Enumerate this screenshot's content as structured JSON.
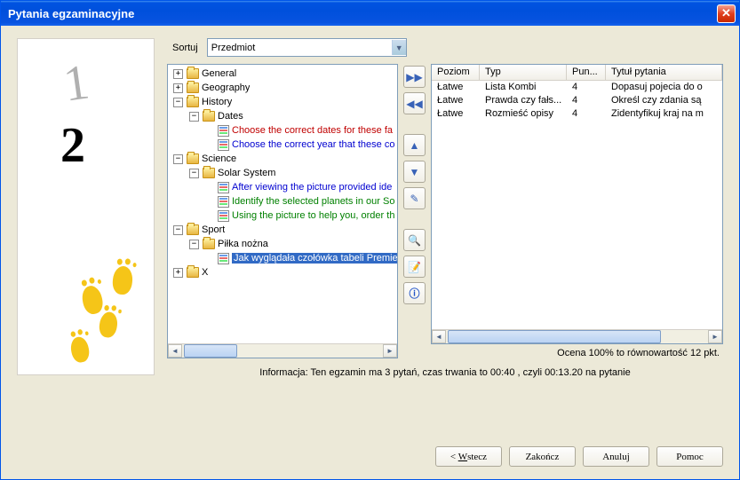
{
  "window": {
    "title": "Pytania egzaminacyjne"
  },
  "sort": {
    "label": "Sortuj",
    "value": "Przedmiot"
  },
  "tree": {
    "general": "General",
    "geography": "Geography",
    "history": "History",
    "dates": "Dates",
    "dates_q1": "Choose the correct dates for these fa",
    "dates_q2": "Choose the correct year that these co",
    "science": "Science",
    "solar": "Solar System",
    "solar_q1": "After viewing the picture provided ide",
    "solar_q2": "Identify the selected planets in our So",
    "solar_q3": "Using the picture to help you, order th",
    "sport": "Sport",
    "pilka": "Piłka nożna",
    "pilka_q1": "Jak wyglądała czołówka tabeli Premie",
    "x": "X"
  },
  "table": {
    "headers": {
      "poziom": "Poziom",
      "typ": "Typ",
      "pun": "Pun...",
      "tytul": "Tytuł pytania"
    },
    "rows": [
      {
        "poziom": "Łatwe",
        "typ": "Lista Kombi",
        "pun": "4",
        "tytul": "Dopasuj pojecia do o"
      },
      {
        "poziom": "Łatwe",
        "typ": "Prawda czy fałs...",
        "pun": "4",
        "tytul": "Określ czy zdania są"
      },
      {
        "poziom": "Łatwe",
        "typ": "Rozmieść opisy",
        "pun": "4",
        "tytul": "Zidentyfikuj kraj na m"
      }
    ]
  },
  "score": "Ocena 100% to równowartość 12 pkt.",
  "info": "Informacja: Ten egzamin ma 3 pytań, czas trwania to 00:40 , czyli 00:13.20 na pytanie",
  "buttons": {
    "back_pre": "< ",
    "back_u": "W",
    "back_post": "stecz",
    "finish": "Zakończ",
    "cancel": "Anuluj",
    "help": "Pomoc"
  }
}
